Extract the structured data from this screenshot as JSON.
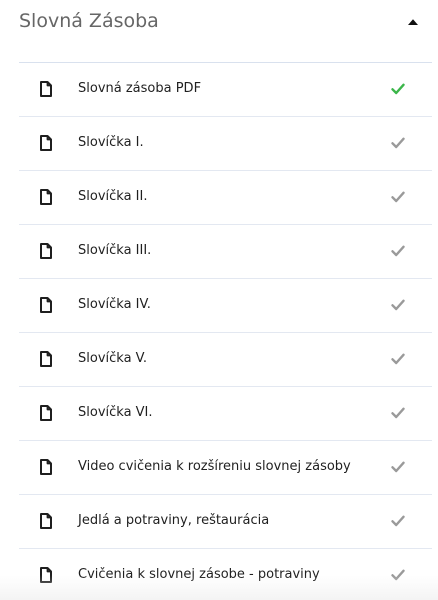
{
  "section": {
    "title": "Slovná Zásoba",
    "toggle_icon": "caret-up-icon"
  },
  "colors": {
    "completed_check": "#3bb64a",
    "pending_check": "#9a9a9a",
    "file_icon": "#1f1f1f",
    "divider": "#e3e8f1"
  },
  "lessons": [
    {
      "title": "Slovná zásoba PDF",
      "icon": "file-icon",
      "status": "completed"
    },
    {
      "title": "Slovíčka I.",
      "icon": "file-icon",
      "status": "pending"
    },
    {
      "title": "Slovíčka II.",
      "icon": "file-icon",
      "status": "pending"
    },
    {
      "title": "Slovíčka III.",
      "icon": "file-icon",
      "status": "pending"
    },
    {
      "title": "Slovíčka IV.",
      "icon": "file-icon",
      "status": "pending"
    },
    {
      "title": "Slovíčka V.",
      "icon": "file-icon",
      "status": "pending"
    },
    {
      "title": "Slovíčka VI.",
      "icon": "file-icon",
      "status": "pending"
    },
    {
      "title": "Video cvičenia k rozšíreniu slovnej zásoby",
      "icon": "file-icon",
      "status": "pending"
    },
    {
      "title": "Jedlá a potraviny, reštaurácia",
      "icon": "file-icon",
      "status": "pending"
    },
    {
      "title": "Cvičenia k slovnej zásobe - potraviny",
      "icon": "file-icon",
      "status": "pending"
    }
  ]
}
